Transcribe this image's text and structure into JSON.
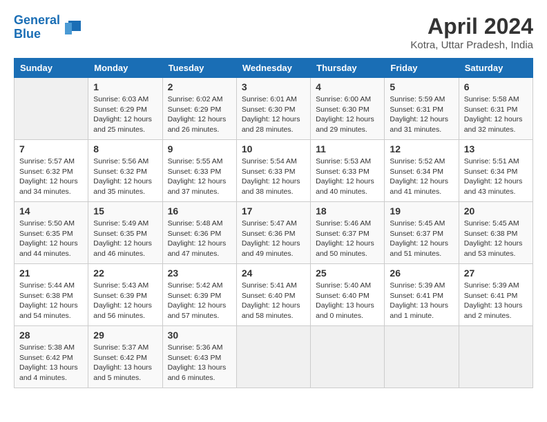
{
  "header": {
    "logo_line1": "General",
    "logo_line2": "Blue",
    "title": "April 2024",
    "subtitle": "Kotra, Uttar Pradesh, India"
  },
  "weekdays": [
    "Sunday",
    "Monday",
    "Tuesday",
    "Wednesday",
    "Thursday",
    "Friday",
    "Saturday"
  ],
  "weeks": [
    [
      {
        "day": "",
        "info": ""
      },
      {
        "day": "1",
        "info": "Sunrise: 6:03 AM\nSunset: 6:29 PM\nDaylight: 12 hours\nand 25 minutes."
      },
      {
        "day": "2",
        "info": "Sunrise: 6:02 AM\nSunset: 6:29 PM\nDaylight: 12 hours\nand 26 minutes."
      },
      {
        "day": "3",
        "info": "Sunrise: 6:01 AM\nSunset: 6:30 PM\nDaylight: 12 hours\nand 28 minutes."
      },
      {
        "day": "4",
        "info": "Sunrise: 6:00 AM\nSunset: 6:30 PM\nDaylight: 12 hours\nand 29 minutes."
      },
      {
        "day": "5",
        "info": "Sunrise: 5:59 AM\nSunset: 6:31 PM\nDaylight: 12 hours\nand 31 minutes."
      },
      {
        "day": "6",
        "info": "Sunrise: 5:58 AM\nSunset: 6:31 PM\nDaylight: 12 hours\nand 32 minutes."
      }
    ],
    [
      {
        "day": "7",
        "info": "Sunrise: 5:57 AM\nSunset: 6:32 PM\nDaylight: 12 hours\nand 34 minutes."
      },
      {
        "day": "8",
        "info": "Sunrise: 5:56 AM\nSunset: 6:32 PM\nDaylight: 12 hours\nand 35 minutes."
      },
      {
        "day": "9",
        "info": "Sunrise: 5:55 AM\nSunset: 6:33 PM\nDaylight: 12 hours\nand 37 minutes."
      },
      {
        "day": "10",
        "info": "Sunrise: 5:54 AM\nSunset: 6:33 PM\nDaylight: 12 hours\nand 38 minutes."
      },
      {
        "day": "11",
        "info": "Sunrise: 5:53 AM\nSunset: 6:33 PM\nDaylight: 12 hours\nand 40 minutes."
      },
      {
        "day": "12",
        "info": "Sunrise: 5:52 AM\nSunset: 6:34 PM\nDaylight: 12 hours\nand 41 minutes."
      },
      {
        "day": "13",
        "info": "Sunrise: 5:51 AM\nSunset: 6:34 PM\nDaylight: 12 hours\nand 43 minutes."
      }
    ],
    [
      {
        "day": "14",
        "info": "Sunrise: 5:50 AM\nSunset: 6:35 PM\nDaylight: 12 hours\nand 44 minutes."
      },
      {
        "day": "15",
        "info": "Sunrise: 5:49 AM\nSunset: 6:35 PM\nDaylight: 12 hours\nand 46 minutes."
      },
      {
        "day": "16",
        "info": "Sunrise: 5:48 AM\nSunset: 6:36 PM\nDaylight: 12 hours\nand 47 minutes."
      },
      {
        "day": "17",
        "info": "Sunrise: 5:47 AM\nSunset: 6:36 PM\nDaylight: 12 hours\nand 49 minutes."
      },
      {
        "day": "18",
        "info": "Sunrise: 5:46 AM\nSunset: 6:37 PM\nDaylight: 12 hours\nand 50 minutes."
      },
      {
        "day": "19",
        "info": "Sunrise: 5:45 AM\nSunset: 6:37 PM\nDaylight: 12 hours\nand 51 minutes."
      },
      {
        "day": "20",
        "info": "Sunrise: 5:45 AM\nSunset: 6:38 PM\nDaylight: 12 hours\nand 53 minutes."
      }
    ],
    [
      {
        "day": "21",
        "info": "Sunrise: 5:44 AM\nSunset: 6:38 PM\nDaylight: 12 hours\nand 54 minutes."
      },
      {
        "day": "22",
        "info": "Sunrise: 5:43 AM\nSunset: 6:39 PM\nDaylight: 12 hours\nand 56 minutes."
      },
      {
        "day": "23",
        "info": "Sunrise: 5:42 AM\nSunset: 6:39 PM\nDaylight: 12 hours\nand 57 minutes."
      },
      {
        "day": "24",
        "info": "Sunrise: 5:41 AM\nSunset: 6:40 PM\nDaylight: 12 hours\nand 58 minutes."
      },
      {
        "day": "25",
        "info": "Sunrise: 5:40 AM\nSunset: 6:40 PM\nDaylight: 13 hours\nand 0 minutes."
      },
      {
        "day": "26",
        "info": "Sunrise: 5:39 AM\nSunset: 6:41 PM\nDaylight: 13 hours\nand 1 minute."
      },
      {
        "day": "27",
        "info": "Sunrise: 5:39 AM\nSunset: 6:41 PM\nDaylight: 13 hours\nand 2 minutes."
      }
    ],
    [
      {
        "day": "28",
        "info": "Sunrise: 5:38 AM\nSunset: 6:42 PM\nDaylight: 13 hours\nand 4 minutes."
      },
      {
        "day": "29",
        "info": "Sunrise: 5:37 AM\nSunset: 6:42 PM\nDaylight: 13 hours\nand 5 minutes."
      },
      {
        "day": "30",
        "info": "Sunrise: 5:36 AM\nSunset: 6:43 PM\nDaylight: 13 hours\nand 6 minutes."
      },
      {
        "day": "",
        "info": ""
      },
      {
        "day": "",
        "info": ""
      },
      {
        "day": "",
        "info": ""
      },
      {
        "day": "",
        "info": ""
      }
    ]
  ]
}
